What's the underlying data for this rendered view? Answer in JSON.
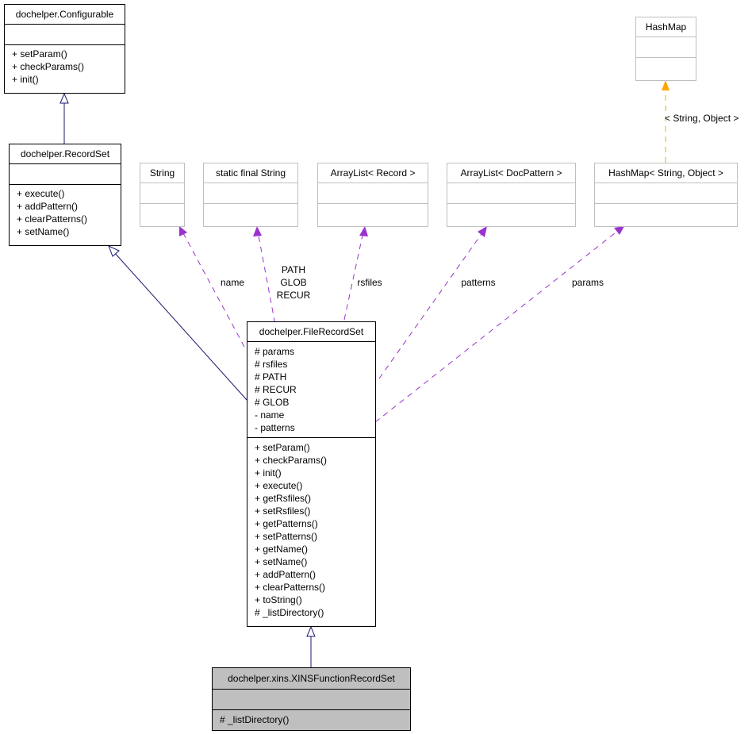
{
  "classes": {
    "configurable": {
      "name": "dochelper.Configurable",
      "attributes": [],
      "methods": [
        "+ setParam()",
        "+ checkParams()",
        "+ init()"
      ]
    },
    "recordset": {
      "name": "dochelper.RecordSet",
      "attributes": [],
      "methods": [
        "+ execute()",
        "+ addPattern()",
        "+ clearPatterns()",
        "+ setName()"
      ]
    },
    "string": {
      "name": "String"
    },
    "static_final_string": {
      "name": "static final String"
    },
    "arraylist_record": {
      "name": "ArrayList< Record >"
    },
    "arraylist_docpattern": {
      "name": "ArrayList< DocPattern >"
    },
    "hashmap_string_object": {
      "name": "HashMap< String, Object >"
    },
    "hashmap": {
      "name": "HashMap"
    },
    "filerecordset": {
      "name": "dochelper.FileRecordSet",
      "attributes": [
        "# params",
        "# rsfiles",
        "# PATH",
        "# RECUR",
        "# GLOB",
        "- name",
        "- patterns"
      ],
      "methods": [
        "+ setParam()",
        "+ checkParams()",
        "+ init()",
        "+ execute()",
        "+ getRsfiles()",
        "+ setRsfiles()",
        "+ getPatterns()",
        "+ setPatterns()",
        "+ getName()",
        "+ setName()",
        "+ addPattern()",
        "+ clearPatterns()",
        "+ toString()",
        "# _listDirectory()"
      ]
    },
    "xinsfunctionrecordset": {
      "name": "dochelper.xins.XINSFunctionRecordSet",
      "attributes": [],
      "methods": [
        "# _listDirectory()"
      ]
    }
  },
  "edge_labels": {
    "name": "name",
    "static_fields": [
      "PATH",
      "GLOB",
      "RECUR"
    ],
    "rsfiles": "rsfiles",
    "patterns": "patterns",
    "params": "params",
    "template": "< String, Object >"
  },
  "colors": {
    "inheritance": "#191970",
    "usage": "#9a32cd",
    "template": "#ffa500",
    "highlight_fill": "#bfbfbf",
    "light_border": "#bfbfbf"
  }
}
